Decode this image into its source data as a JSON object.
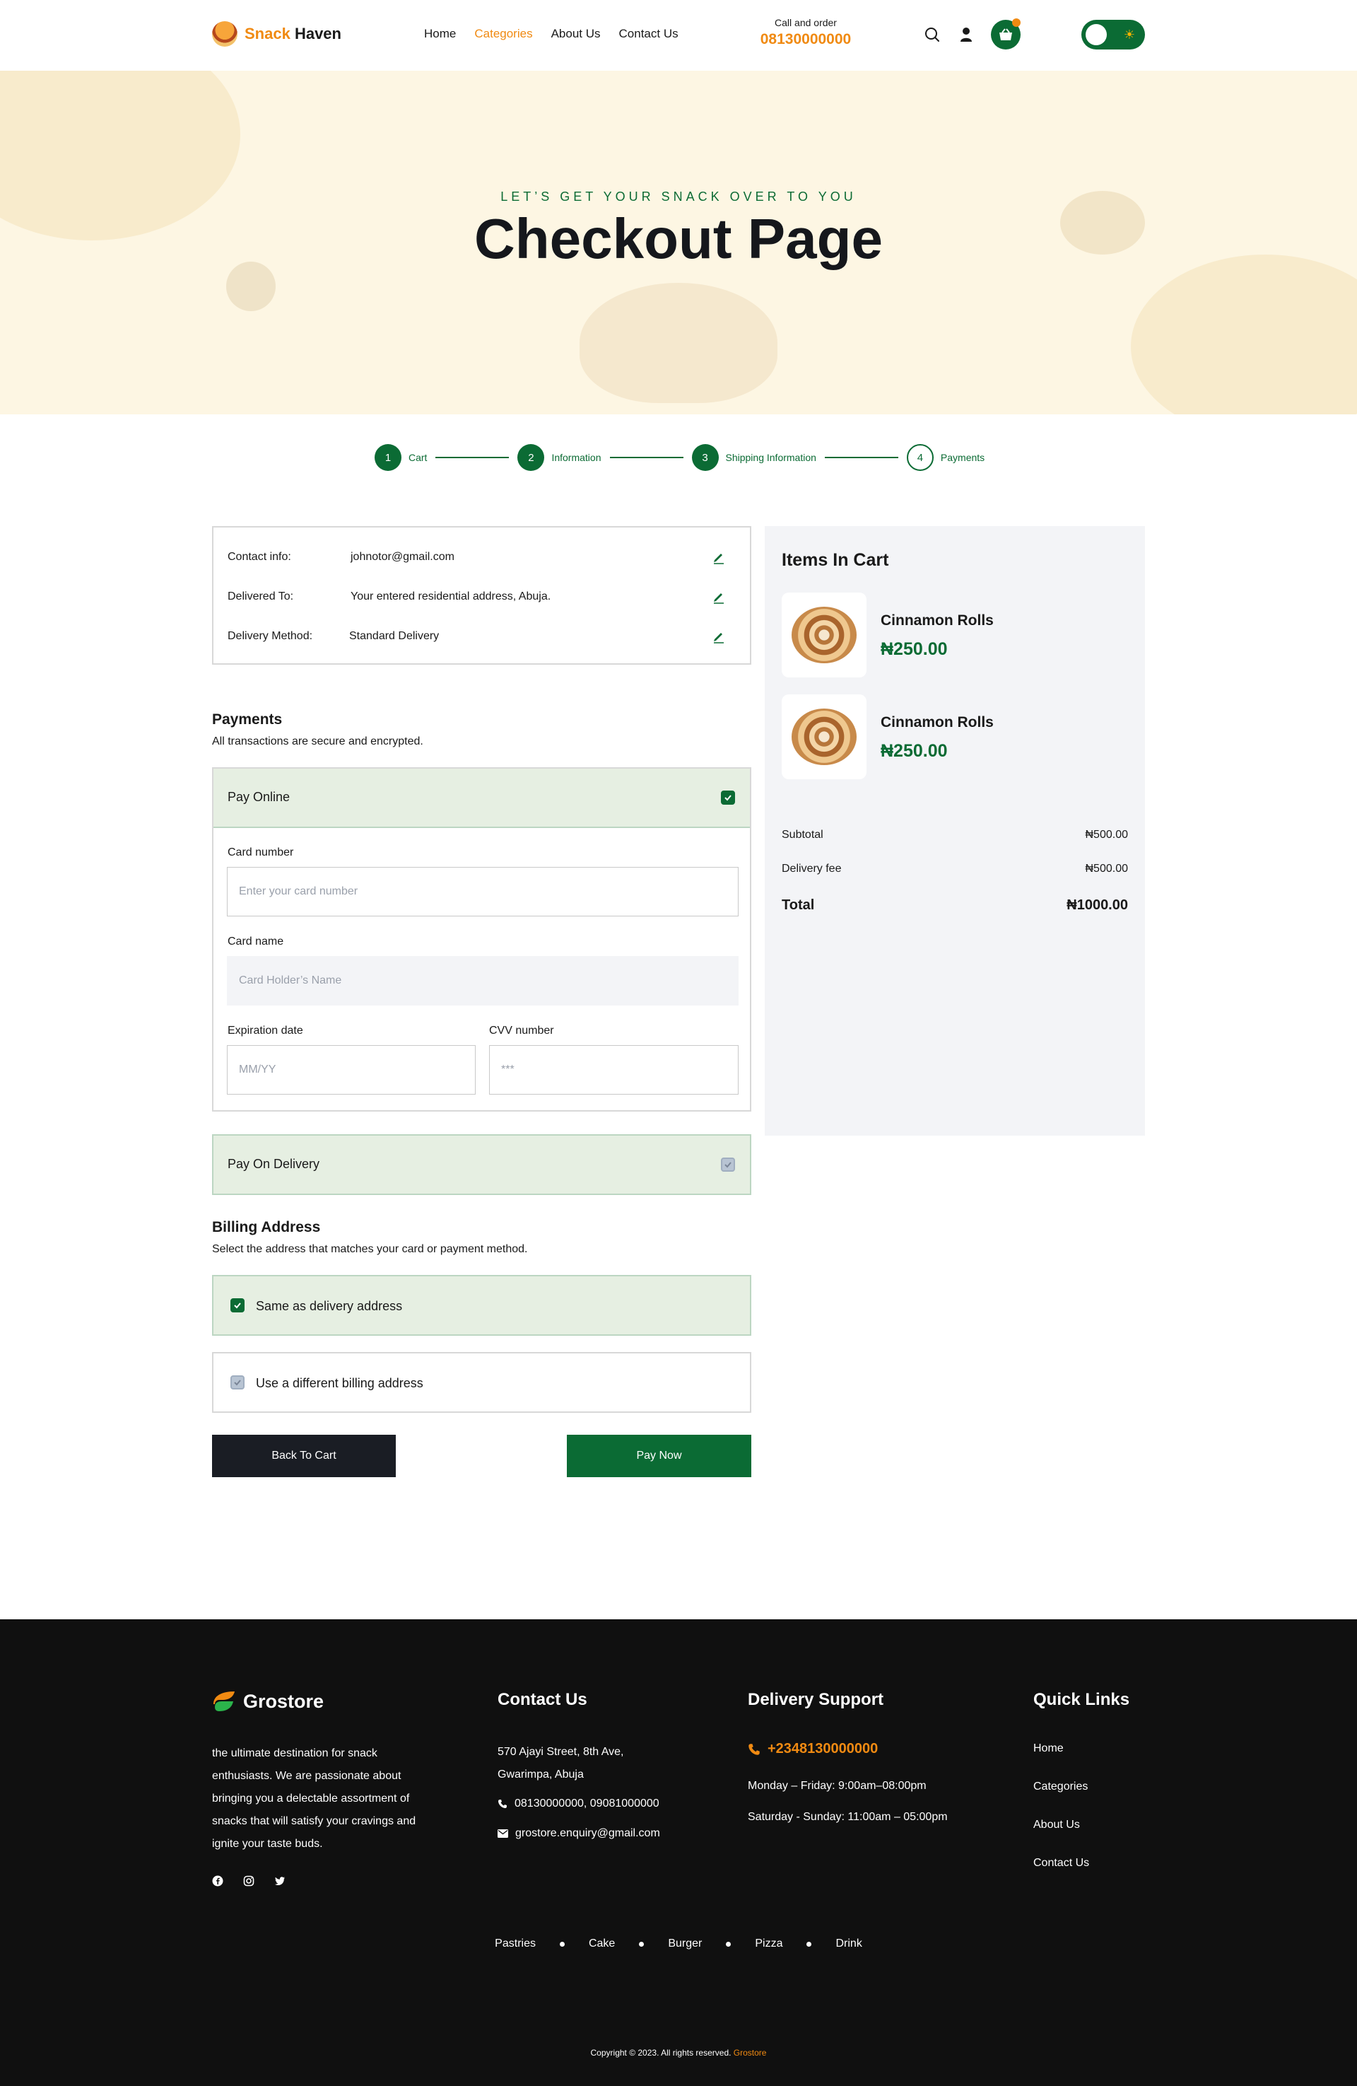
{
  "header": {
    "brand_part1": "Snack",
    "brand_part2": "Haven",
    "nav": [
      "Home",
      "Categories",
      "About Us",
      "Contact Us"
    ],
    "active_nav": "Categories",
    "call_label": "Call and order",
    "call_number": "08130000000",
    "icons": [
      "search-icon",
      "user-icon",
      "basket-icon",
      "sun-icon"
    ],
    "accent_color": "#f08a12",
    "brand_green": "#0b6b34"
  },
  "hero": {
    "subtitle": "LET’S GET YOUR SNACK OVER TO YOU",
    "title": "Checkout Page"
  },
  "stepper": {
    "steps": [
      {
        "num": "1",
        "label": "Cart",
        "done": true
      },
      {
        "num": "2",
        "label": "Information",
        "done": true
      },
      {
        "num": "3",
        "label": "Shipping Information",
        "done": true
      },
      {
        "num": "4",
        "label": "Payments",
        "done": false
      }
    ]
  },
  "info": {
    "rows": [
      {
        "label": "Contact info:",
        "value": "johnotor@gmail.com"
      },
      {
        "label": "Delivered To:",
        "value": "Your entered residential address, Abuja."
      },
      {
        "label": "Delivery Method:",
        "value": "Standard Delivery"
      }
    ]
  },
  "payments": {
    "title": "Payments",
    "subtitle": "All transactions are secure and encrypted.",
    "online_label": "Pay Online",
    "online_checked": true,
    "card_number_label": "Card number",
    "card_number_placeholder": "Enter your card number",
    "card_name_label": "Card name",
    "card_name_placeholder": "Card Holder’s Name",
    "expiry_label": "Expiration date",
    "expiry_placeholder": "MM/YY",
    "cvv_label": "CVV number",
    "cvv_placeholder": "***",
    "cod_label": "Pay On Delivery",
    "cod_checked": false
  },
  "billing": {
    "title": "Billing Address",
    "subtitle": "Select the address that matches your card or payment method.",
    "same_label": "Same as delivery address",
    "same_checked": true,
    "different_label": "Use a different billing address",
    "different_checked": false
  },
  "buttons": {
    "back": "Back To Cart",
    "pay": "Pay Now"
  },
  "cart": {
    "title": "Items In Cart",
    "items": [
      {
        "name": "Cinnamon Rolls",
        "price": "₦250.00"
      },
      {
        "name": "Cinnamon Rolls",
        "price": "₦250.00"
      }
    ],
    "subtotal_label": "Subtotal",
    "subtotal": "₦500.00",
    "delivery_label": "Delivery fee",
    "delivery": "₦500.00",
    "total_label": "Total",
    "total": "₦1000.00"
  },
  "footer": {
    "brand": "Grostore",
    "about": "the ultimate destination for snack enthusiasts. We are passionate about bringing you a delectable assortment of snacks that will satisfy your cravings and ignite your taste buds.",
    "socials": [
      "facebook-icon",
      "instagram-icon",
      "twitter-icon"
    ],
    "contact_title": "Contact Us",
    "address_line1": "570 Ajayi Street, 8th Ave,",
    "address_line2": "Gwarimpa, Abuja",
    "phones": "08130000000,  09081000000",
    "email": "grostore.enquiry@gmail.com",
    "support_title": "Delivery Support",
    "support_phone": "+2348130000000",
    "hours_weekday": "Monday – Friday: 9:00am–08:00pm",
    "hours_weekend": "Saturday - Sunday: 11:00am – 05:00pm",
    "links_title": "Quick Links",
    "links": [
      "Home",
      "Categories",
      "About Us",
      "Contact Us"
    ],
    "categories": [
      "Pastries",
      "Cake",
      "Burger",
      "Pizza",
      "Drink"
    ],
    "copyright": "Copyright © 2023. All rights reserved.",
    "copyright_brand": "Grostore"
  }
}
